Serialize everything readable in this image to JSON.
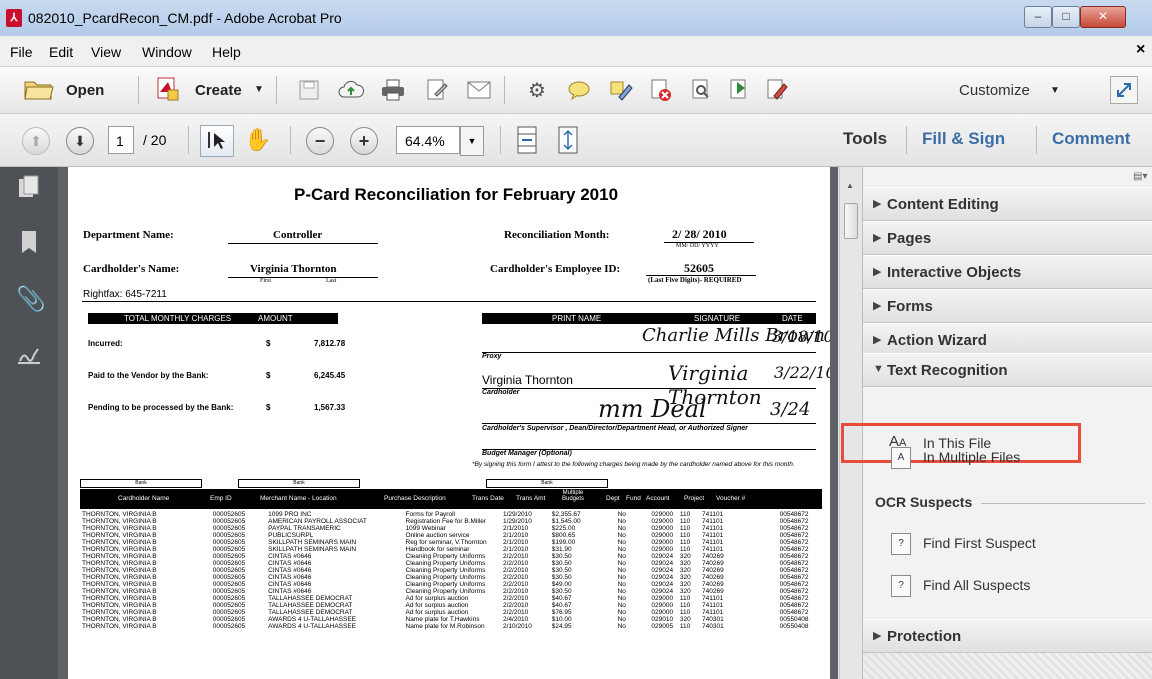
{
  "window": {
    "title": "082010_PcardRecon_CM.pdf - Adobe Acrobat Pro",
    "minimize": "–",
    "maximize": "□",
    "close": "✕"
  },
  "menubar": {
    "items": [
      "File",
      "Edit",
      "View",
      "Window",
      "Help"
    ],
    "close_doc": "×"
  },
  "toolbar1": {
    "open_label": "Open",
    "create_label": "Create",
    "customize_label": "Customize"
  },
  "toolbar2": {
    "page_current": "1",
    "page_total": "/ 20",
    "zoom": "64.4%",
    "tabs": [
      "Tools",
      "Fill & Sign",
      "Comment"
    ]
  },
  "right_pane": {
    "sections_top": [
      "Content Editing",
      "Pages",
      "Interactive Objects",
      "Forms",
      "Action Wizard"
    ],
    "text_recognition": {
      "label": "Text Recognition",
      "items": [
        "In This File",
        "In Multiple Files"
      ]
    },
    "ocr_suspects": {
      "label": "OCR Suspects",
      "items": [
        "Find First Suspect",
        "Find All Suspects"
      ]
    },
    "protection": "Protection",
    "highlight_color": "#e74c3c"
  },
  "doc": {
    "title": "P-Card Reconciliation for February 2010",
    "dept_label": "Department Name:",
    "dept_value": "Controller",
    "recon_label": "Reconciliation Month:",
    "recon_value": "2/ 28/ 2010",
    "recon_sub": "MM/ DD/ YYYY",
    "holder_label": "Cardholder's Name:",
    "holder_value": "Virginia Thornton",
    "holder_first": "First",
    "holder_last": "Last",
    "empid_label": "Cardholder's Employee ID:",
    "empid_value": "52605",
    "empid_sub": "(Last Five Digits)- REQUIRED",
    "rightfax": "Rightfax: 645-7211",
    "charges_hdr": "TOTAL MONTHLY CHARGES",
    "amount_hdr": "AMOUNT",
    "print_name_hdr": "PRINT NAME",
    "signature_hdr": "SIGNATURE",
    "date_hdr": "DATE",
    "incurred_label": "Incurred:",
    "incurred_value": "7,812.78",
    "paid_label": "Paid to the Vendor by the Bank:",
    "paid_value": "6,245.45",
    "pending_label": "Pending to be processed by the Bank:",
    "pending_value": "1,567.33",
    "dollar": "$",
    "proxy_label": "Proxy",
    "printed_name": "Virginia Thornton",
    "cardholder_label": "Cardholder",
    "supervisor_label": "Cardholder's Supervisor , Dean/Director/Department Head, or Authorized Signer",
    "budget_label": "Budget Manager (Optional)",
    "attest_text": "*By signing this form I attest to the following charges being made by the cardholder named above for this month.",
    "bank_tags": [
      "Bank",
      "Bank",
      "Bank"
    ],
    "sig1": "Charlie Mills Brown",
    "sig1_date": "3/18/10",
    "sig2": "Virginia Thornton",
    "sig2_date": "3/22/10",
    "sig3": "mm Deal",
    "sig3_date": "3/24",
    "table_headers": [
      "Cardholder Name",
      "Emp ID",
      "Merchant Name - Location",
      "Purchase Description",
      "Trans Date",
      "Trans Amt",
      "Multiple Budgets",
      "Dept",
      "Fund",
      "Account",
      "Project",
      "Voucher #"
    ],
    "rows": [
      [
        "THORNTON, VIRGINIA B",
        "000052605",
        "1099 PRO INC",
        "Forms for Payroll",
        "1/29/2010",
        "$2,355.67",
        "No",
        "029000",
        "110",
        "741101",
        "",
        "00548672"
      ],
      [
        "THORNTON, VIRGINIA B",
        "000052605",
        "AMERICAN PAYROLL ASSOCIAT",
        "Registration Fee for B.Miller",
        "1/29/2010",
        "$1,545.00",
        "No",
        "029000",
        "110",
        "741101",
        "",
        "00548672"
      ],
      [
        "THORNTON, VIRGINIA B",
        "000052605",
        "PAYPAL TRANSAMERIC",
        "1099 Webinar",
        "2/1/2010",
        "$225.00",
        "No",
        "029000",
        "110",
        "741101",
        "",
        "00548672"
      ],
      [
        "THORNTON, VIRGINIA B",
        "000052605",
        "PUBLICSURPL",
        "Online auction service",
        "2/1/2010",
        "$800.65",
        "No",
        "029000",
        "110",
        "741101",
        "",
        "00548672"
      ],
      [
        "THORNTON, VIRGINIA B",
        "000052605",
        "SKILLPATH SEMINARS MAIN",
        "Reg for seminar, V.Thornton",
        "2/1/2010",
        "$199.00",
        "No",
        "029000",
        "110",
        "741101",
        "",
        "00548672"
      ],
      [
        "THORNTON, VIRGINIA B",
        "000052605",
        "SKILLPATH SEMINARS MAIN",
        "Handbook for seminar",
        "2/1/2010",
        "$31.90",
        "No",
        "029000",
        "110",
        "741101",
        "",
        "00548672"
      ],
      [
        "THORNTON, VIRGINIA B",
        "000052605",
        "CINTAS #0646",
        "Cleaning Property Uniforms",
        "2/2/2010",
        "$30.50",
        "No",
        "029024",
        "320",
        "740269",
        "",
        "00548672"
      ],
      [
        "THORNTON, VIRGINIA B",
        "000052605",
        "CINTAS #0646",
        "Cleaning Property Uniforms",
        "2/2/2010",
        "$30.50",
        "No",
        "029024",
        "320",
        "740269",
        "",
        "00548672"
      ],
      [
        "THORNTON, VIRGINIA B",
        "000052605",
        "CINTAS #0646",
        "Cleaning Property Uniforms",
        "2/2/2010",
        "$30.50",
        "No",
        "029024",
        "320",
        "740269",
        "",
        "00548672"
      ],
      [
        "THORNTON, VIRGINIA B",
        "000052605",
        "CINTAS #0646",
        "Cleaning Property Uniforms",
        "2/2/2010",
        "$30.50",
        "No",
        "029024",
        "320",
        "740269",
        "",
        "00548672"
      ],
      [
        "THORNTON, VIRGINIA B",
        "000052605",
        "CINTAS #0646",
        "Cleaning Property Uniforms",
        "2/2/2010",
        "$49.00",
        "No",
        "029024",
        "320",
        "740269",
        "",
        "00548672"
      ],
      [
        "THORNTON, VIRGINIA B",
        "000052605",
        "CINTAS #0646",
        "Cleaning Property Uniforms",
        "2/2/2010",
        "$30.50",
        "No",
        "029024",
        "320",
        "740269",
        "",
        "00548672"
      ],
      [
        "THORNTON, VIRGINIA B",
        "000052605",
        "TALLAHASSEE DEMOCRAT",
        "Ad for surplus auction",
        "2/2/2010",
        "$40.67",
        "No",
        "029000",
        "110",
        "741101",
        "",
        "00548672"
      ],
      [
        "THORNTON, VIRGINIA B",
        "000052605",
        "TALLAHASSEE DEMOCRAT",
        "Ad for surplus auction",
        "2/2/2010",
        "$40.67",
        "No",
        "029000",
        "110",
        "741101",
        "",
        "00548672"
      ],
      [
        "THORNTON, VIRGINIA B",
        "000052605",
        "TALLAHASSEE DEMOCRAT",
        "Ad for surplus auction",
        "2/2/2010",
        "$76.95",
        "No",
        "029000",
        "110",
        "741101",
        "",
        "00548672"
      ],
      [
        "THORNTON, VIRGINIA B",
        "000052605",
        "AWARDS 4 U-TALLAHASSEE",
        "Name plate for T.Hawkins",
        "2/4/2010",
        "$10.00",
        "No",
        "029010",
        "320",
        "740301",
        "",
        "00550408"
      ],
      [
        "THORNTON, VIRGINIA B",
        "000052605",
        "AWARDS 4 U-TALLAHASSEE",
        "Name plate for M.Robinson",
        "2/10/2010",
        "$24.95",
        "No",
        "029005",
        "110",
        "740301",
        "",
        "00550408"
      ]
    ]
  }
}
